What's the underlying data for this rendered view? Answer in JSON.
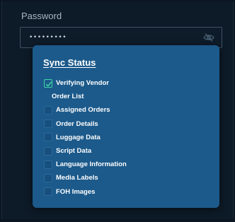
{
  "form": {
    "password_label": "Password",
    "password_value": "•••••••••"
  },
  "icons": {
    "visibility_toggle": "eye-off-icon",
    "checked": "checkmark-icon"
  },
  "sync_status": {
    "title": "Sync Status",
    "items": [
      {
        "label": "Verifying Vendor",
        "checked": true
      },
      {
        "label": "Order List",
        "checked": false
      },
      {
        "label": "Assigned Orders",
        "checked": false
      },
      {
        "label": "Order Details",
        "checked": false
      },
      {
        "label": "Luggage Data",
        "checked": false
      },
      {
        "label": "Script Data",
        "checked": false
      },
      {
        "label": "Language Information",
        "checked": false
      },
      {
        "label": "Media Labels",
        "checked": false
      },
      {
        "label": "FOH Images",
        "checked": false
      }
    ]
  },
  "colors": {
    "background": "#0d1a27",
    "popup": "#1c5a8b",
    "check_accent": "#3fd3a6"
  }
}
